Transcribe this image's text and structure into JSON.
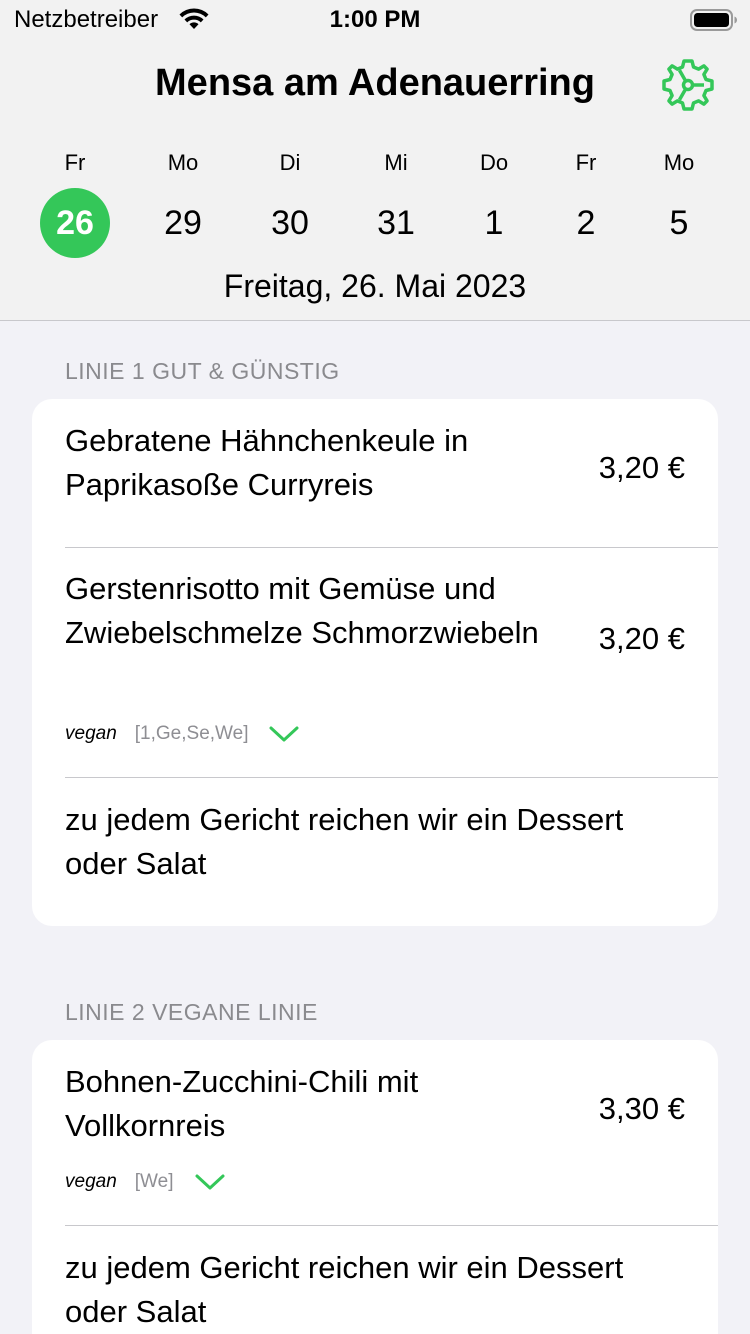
{
  "status_bar": {
    "carrier": "Netzbetreiber",
    "time": "1:00 PM",
    "wifi_icon": "wifi-icon",
    "battery_icon": "battery-icon"
  },
  "header": {
    "title": "Mensa am Adenauerring",
    "settings_icon": "gear-icon",
    "accent_color": "#34c759"
  },
  "days": [
    {
      "name": "Fr",
      "num": "26",
      "selected": true
    },
    {
      "name": "Mo",
      "num": "29"
    },
    {
      "name": "Di",
      "num": "30"
    },
    {
      "name": "Mi",
      "num": "31"
    },
    {
      "name": "Do",
      "num": "1"
    },
    {
      "name": "Fr",
      "num": "2"
    },
    {
      "name": "Mo",
      "num": "5"
    }
  ],
  "selected_date": "Freitag, 26. Mai 2023",
  "sections": [
    {
      "title": "LINIE 1 GUT & GÜNSTIG",
      "items": [
        {
          "name": "Gebratene Hähnchenkeule in Paprikasoße Curryreis",
          "price": "3,20 €"
        },
        {
          "name": "Gerstenrisotto mit Gemüse und Zwiebelschmelze Schmorzwiebeln",
          "price": "3,20 €",
          "diet": "vegan",
          "allergens": "[1,Ge,Se,We]"
        },
        {
          "name": "zu jedem Gericht reichen wir ein Dessert oder Salat"
        }
      ]
    },
    {
      "title": "LINIE 2 VEGANE LINIE",
      "items": [
        {
          "name": "Bohnen-Zucchini-Chili mit Vollkornreis",
          "price": "3,30 €",
          "diet": "vegan",
          "allergens": "[We]"
        },
        {
          "name": "zu jedem Gericht reichen wir ein Dessert oder Salat"
        }
      ]
    }
  ]
}
